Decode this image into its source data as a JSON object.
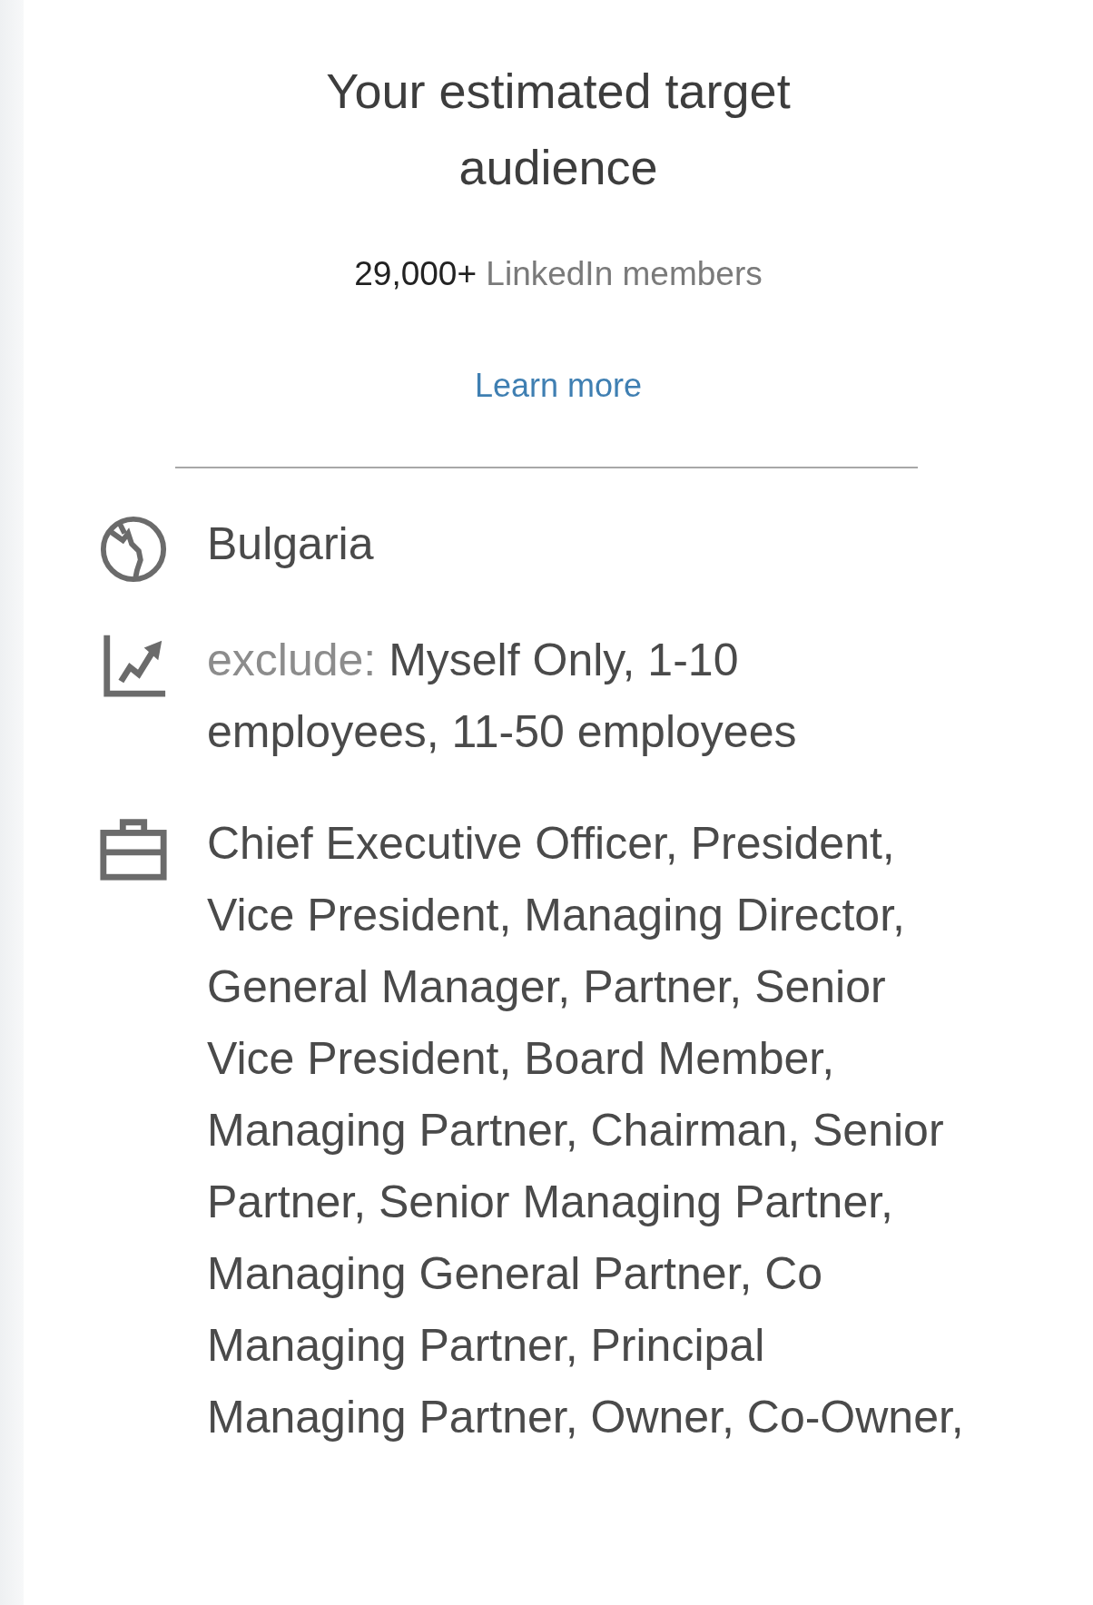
{
  "title": "Your estimated target audience",
  "audience": {
    "count": "29,000+",
    "label": "LinkedIn members"
  },
  "learn_more": "Learn more",
  "criteria": [
    {
      "kind": "location",
      "text": "Bulgaria"
    },
    {
      "kind": "company_size",
      "prefix": "exclude:",
      "text": "Myself Only, 1-10 employees, 11-50 employees"
    },
    {
      "kind": "job_title",
      "text": "Chief Executive Officer, President, Vice President, Managing Director, General Manager, Partner, Senior Vice President, Board Member, Managing Partner, Chairman, Senior Partner, Senior Managing Partner, Managing General Partner, Co Managing Partner, Principal Managing Partner, Owner, Co-Owner,"
    }
  ]
}
